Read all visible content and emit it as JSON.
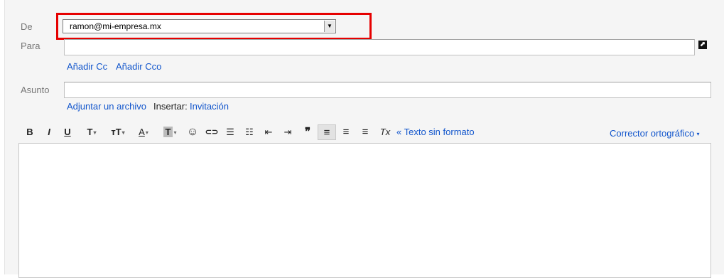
{
  "from": {
    "label": "De",
    "value": "ramon@mi-empresa.mx"
  },
  "to": {
    "label": "Para",
    "value": ""
  },
  "cc_bcc": {
    "add_cc": "Añadir Cc",
    "add_bcc": "Añadir Cco"
  },
  "subject": {
    "label": "Asunto",
    "value": ""
  },
  "attach": {
    "attach_file": "Adjuntar un archivo",
    "insert_label": "Insertar:",
    "invitation": "Invitación"
  },
  "toolbar": {
    "bold": "B",
    "italic": "I",
    "underline": "U",
    "font": "T",
    "size": "ᴛT",
    "text_color": "A",
    "highlight": "T",
    "emoji": "☺",
    "link": "⊂⊃",
    "numbered_list": "☰",
    "bulleted_list": "☷",
    "indent_less": "⇤",
    "indent_more": "⇥",
    "quote": "❞",
    "align_left": "≡",
    "align_center": "≡",
    "align_right": "≡",
    "remove_format": "Tx",
    "plain_text": "« Texto sin formato",
    "spellcheck": "Corrector ortográfico"
  },
  "body": {
    "value": ""
  },
  "colors": {
    "highlight_border": "#e60000",
    "link": "#1155cc"
  }
}
